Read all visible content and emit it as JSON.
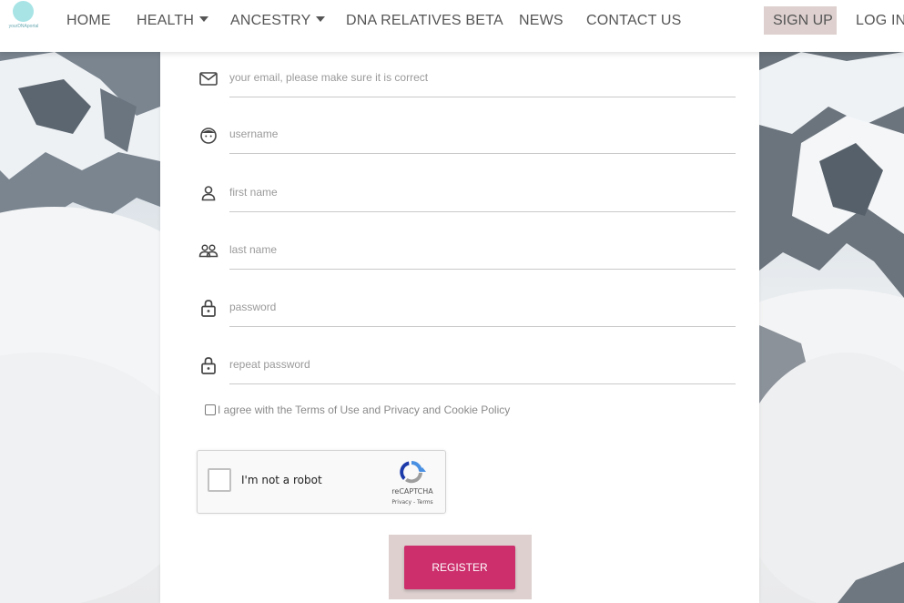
{
  "nav": {
    "logo_text": "yourDNAportal",
    "items": [
      {
        "label": "HOME"
      },
      {
        "label": "HEALTH"
      },
      {
        "label": "ANCESTRY"
      },
      {
        "label": "DNA RELATIVES BETA"
      },
      {
        "label": "NEWS"
      },
      {
        "label": "CONTACT US"
      }
    ],
    "signup": "SIGN UP",
    "login": "LOG IN"
  },
  "form": {
    "fields": [
      {
        "icon": "envelope-icon",
        "placeholder": "your email, please make sure it is correct"
      },
      {
        "icon": "face-icon",
        "placeholder": "username"
      },
      {
        "icon": "user-icon",
        "placeholder": "first name"
      },
      {
        "icon": "users-icon",
        "placeholder": "last name"
      },
      {
        "icon": "lock-icon",
        "placeholder": "password"
      },
      {
        "icon": "lock-icon",
        "placeholder": "repeat password"
      }
    ],
    "agree_label": "I agree with the Terms of Use and Privacy and Cookie Policy",
    "captcha": {
      "label": "I'm not a robot",
      "brand": "reCAPTCHA",
      "links": "Privacy - Terms"
    },
    "register": "REGISTER"
  },
  "colors": {
    "accent": "#cc2f6c",
    "highlight": "#ddd0cf",
    "logo": "#a8e4e6"
  }
}
